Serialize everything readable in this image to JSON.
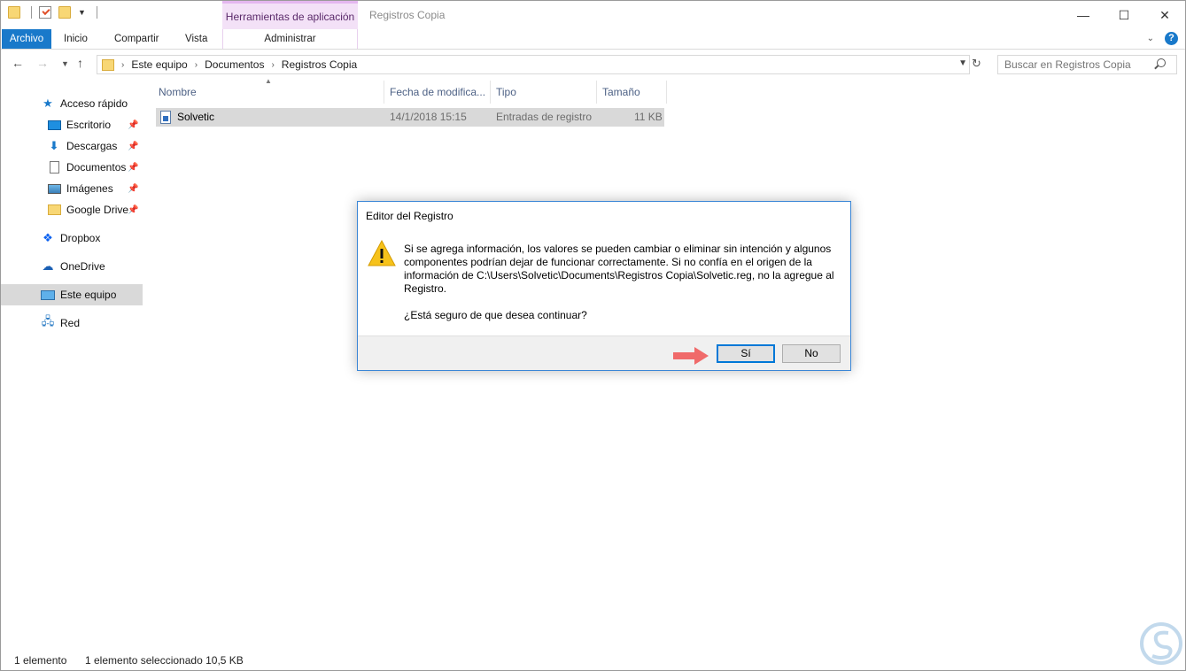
{
  "colors": {
    "accent": "#1979ca",
    "tools_tab_bg": "#f3e1f7",
    "selection": "#d9d9d9",
    "dialog_border": "#3a86d6",
    "arrow": "#f06a6a",
    "warning": "#f6c21b"
  },
  "titlebar": {
    "tools_tab": "Herramientas de aplicación",
    "title": "Registros Copia",
    "controls": {
      "minimize": "—",
      "maximize": "☐",
      "close": "✕"
    }
  },
  "ribbon": {
    "tabs": {
      "archivo": "Archivo",
      "inicio": "Inicio",
      "compartir": "Compartir",
      "vista": "Vista",
      "admin": "Administrar"
    },
    "expand": "⌄",
    "help": "?"
  },
  "address": {
    "crumbs": [
      "Este equipo",
      "Documentos",
      "Registros Copia"
    ],
    "search_placeholder": "Buscar en Registros Copia"
  },
  "navpane": {
    "quick_access": "Acceso rápido",
    "pinned": [
      "Escritorio",
      "Descargas",
      "Documentos",
      "Imágenes",
      "Google Drive"
    ],
    "dropbox": "Dropbox",
    "onedrive": "OneDrive",
    "this_pc": "Este equipo",
    "network": "Red"
  },
  "filelist": {
    "columns": {
      "name": "Nombre",
      "date": "Fecha de modifica...",
      "type": "Tipo",
      "size": "Tamaño"
    },
    "rows": [
      {
        "name": "Solvetic",
        "date": "14/1/2018 15:15",
        "type": "Entradas de registro",
        "size": "11 KB"
      }
    ]
  },
  "status": {
    "count": "1 elemento",
    "selected": "1 elemento seleccionado  10,5 KB"
  },
  "dialog": {
    "title": "Editor del Registro",
    "message": "Si se agrega información, los valores se pueden cambiar o eliminar sin intención y algunos componentes podrían dejar de funcionar correctamente. Si no confía en el origen de la información de C:\\Users\\Solvetic\\Documents\\Registros Copia\\Solvetic.reg, no la agregue al Registro.",
    "question": "¿Está seguro de que desea continuar?",
    "yes_label": "Sí",
    "no_label": "No",
    "icon": "warning-icon"
  }
}
